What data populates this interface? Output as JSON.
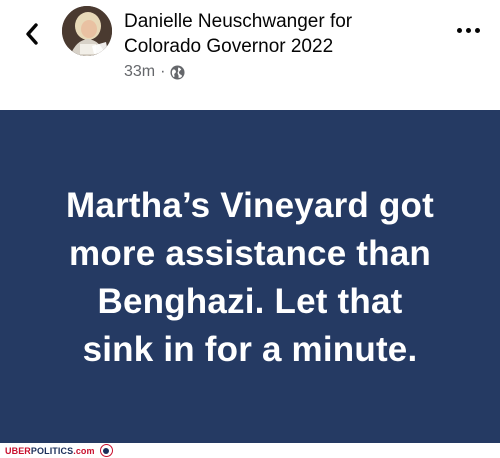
{
  "header": {
    "author_line1": "Danielle Neuschwanger for",
    "author_line2": "Colorado Governor 2022",
    "timestamp": "33m",
    "separator": "·",
    "privacy_icon": "globe-icon",
    "back_icon": "chevron-left-icon",
    "more_icon": "more-horizontal-icon"
  },
  "post": {
    "background_color": "#253a63",
    "text_color": "#ffffff",
    "lines": [
      "Martha’s Vineyard got",
      "more assistance than",
      "Benghazi. Let that",
      "sink in for a minute."
    ]
  },
  "footer": {
    "brand_uber": "UBER",
    "brand_politics": "POLITICS",
    "brand_tld": ".com"
  }
}
